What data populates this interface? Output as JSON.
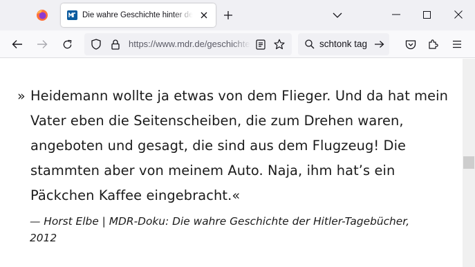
{
  "browser": {
    "tab": {
      "title": "Die wahre Geschichte hinter der Fälschung"
    },
    "urlbar": {
      "url": "https://www.mdr.de/geschichte"
    },
    "searchbar": {
      "query": "schtonk tag"
    },
    "colors": {
      "tabstrip_bg": "#f0f0f4",
      "toolbar_bg": "#f9f9fb",
      "favicon": "#0a5b9f"
    }
  },
  "article": {
    "quote_open": "»",
    "quote_lines": [
      "Heidemann wollte ja etwas von dem Flieger. Und da hat mein",
      "Vater eben die Seitenscheiben, die zum Drehen waren,",
      "angeboten und gesagt, die sind aus dem Flugzeug! Die",
      "stammten aber von meinem Auto. Naja, ihm hat’s ein",
      "Päckchen Kaffee eingebracht.«"
    ],
    "source_lines": [
      "— Horst Elbe | MDR-Doku: Die wahre Geschichte der Hitler-Tagebücher,",
      "2012"
    ]
  }
}
